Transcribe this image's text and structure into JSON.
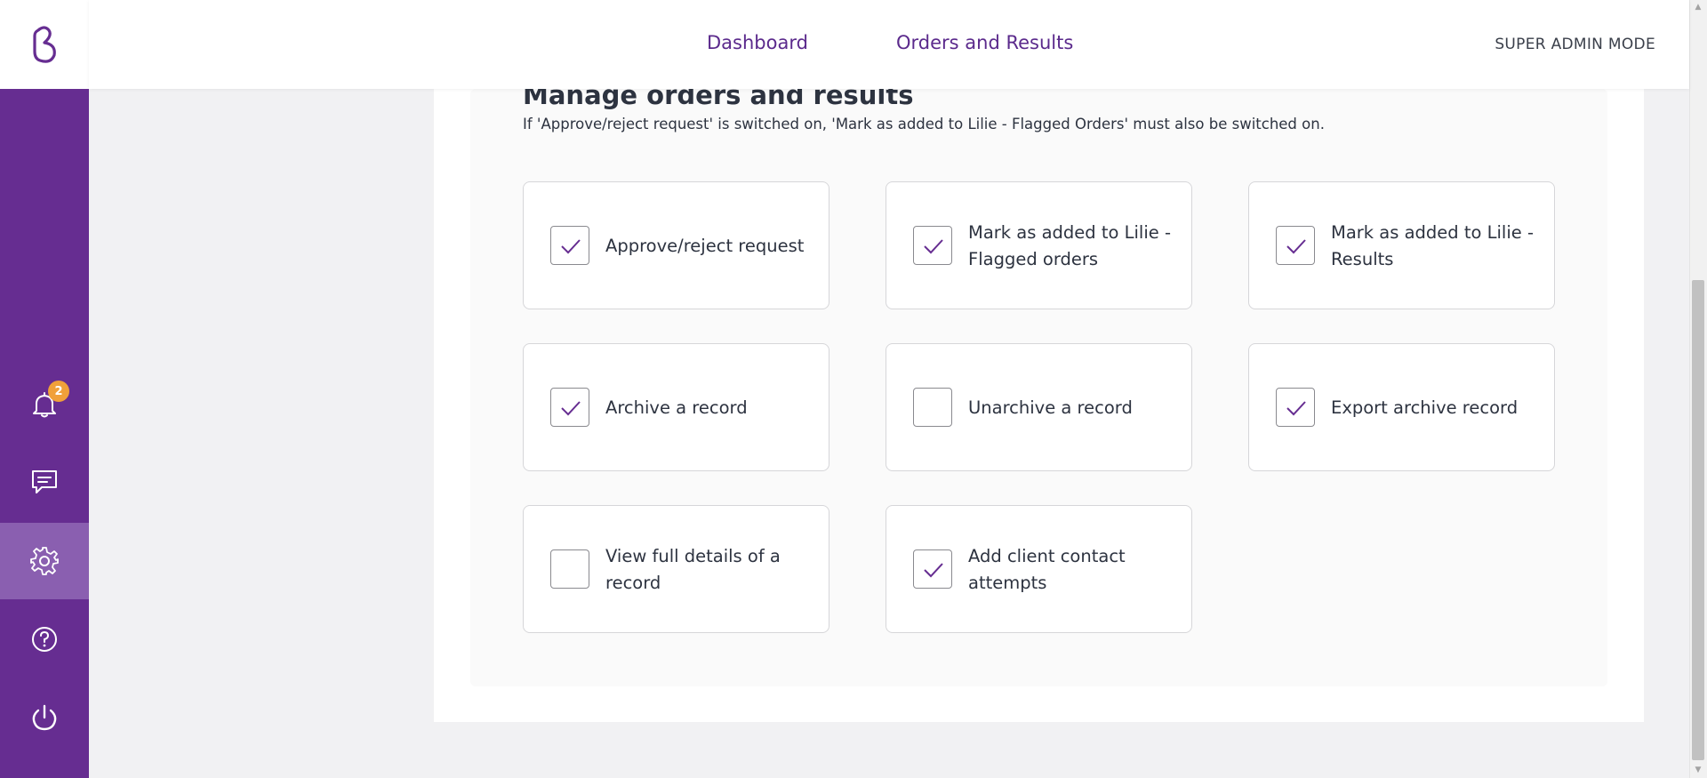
{
  "nav": {
    "links": [
      "Dashboard",
      "Orders and Results"
    ],
    "mode": "SUPER ADMIN MODE"
  },
  "sidebar": {
    "notifications_count": "2",
    "items": [
      {
        "icon": "bell-icon"
      },
      {
        "icon": "chat-icon"
      },
      {
        "icon": "gear-icon",
        "active": true
      },
      {
        "icon": "help-icon"
      },
      {
        "icon": "power-icon"
      }
    ]
  },
  "section": {
    "title": "Manage orders and results",
    "note": "If 'Approve/reject request' is switched on, 'Mark as added to Lilie - Flagged Orders' must also be switched on.",
    "permissions": [
      {
        "label": "Approve/reject request",
        "checked": true
      },
      {
        "label": "Mark as added to Lilie - Flagged orders",
        "checked": true
      },
      {
        "label": "Mark as added to Lilie - Results",
        "checked": true
      },
      {
        "label": "Archive a record",
        "checked": true
      },
      {
        "label": "Unarchive a record",
        "checked": false
      },
      {
        "label": "Export archive record",
        "checked": true
      },
      {
        "label": "View full details of a record",
        "checked": false
      },
      {
        "label": "Add client contact attempts",
        "checked": true
      }
    ]
  },
  "colors": {
    "brand": "#662d91",
    "sidebar_active": "#8a5fb0",
    "badge": "#f0a03a",
    "link": "#5b2a8c"
  }
}
